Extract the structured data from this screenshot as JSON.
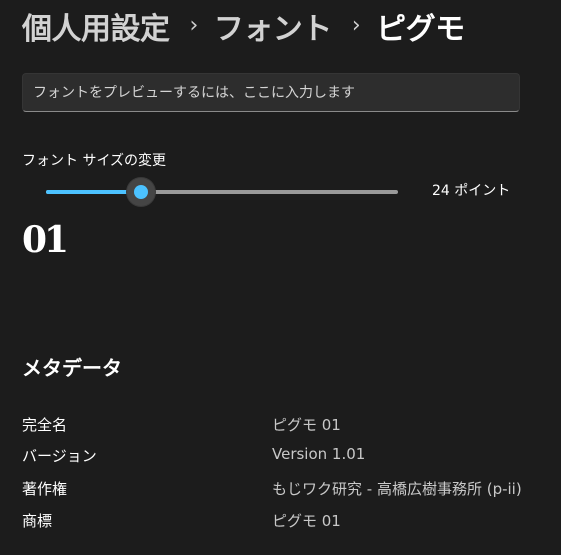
{
  "breadcrumb": {
    "items": [
      "個人用設定",
      "フォント",
      "ピグモ"
    ],
    "separator": "›"
  },
  "preview": {
    "placeholder": "フォントをプレビューするには、ここに入力します",
    "value": ""
  },
  "font_size": {
    "label": "フォント サイズの変更",
    "value_text": "24 ポイント",
    "slider_fraction": 0.27,
    "accent_color": "#4cc2ff"
  },
  "sample_text": "01",
  "metadata": {
    "heading": "メタデータ",
    "rows": [
      {
        "key": "完全名",
        "value": "ピグモ 01"
      },
      {
        "key": "バージョン",
        "value": "Version 1.01"
      },
      {
        "key": "著作権",
        "value": "もじワク研究 - 高橋広樹事務所 (p-ii)"
      },
      {
        "key": "商標",
        "value": "ピグモ 01"
      }
    ]
  }
}
